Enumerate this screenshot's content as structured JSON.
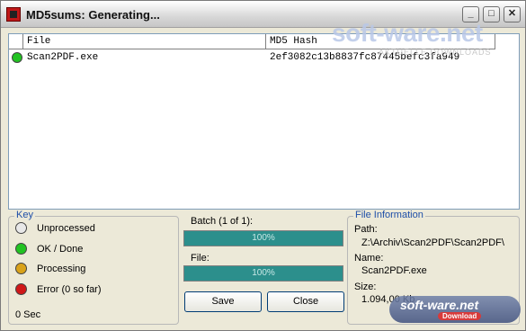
{
  "window": {
    "title": "MD5sums: Generating..."
  },
  "titlebar_buttons": {
    "minimize": "_",
    "maximize": "□",
    "close": "✕"
  },
  "list": {
    "columns": [
      "File",
      "MD5 Hash"
    ],
    "rows": [
      {
        "status": "ok",
        "file": "Scan2PDF.exe",
        "hash": "2ef3082c13b8837fc87445befc3fa949"
      }
    ]
  },
  "key": {
    "title": "Key",
    "items": [
      {
        "label": "Unprocessed",
        "color": "#e8e8e8"
      },
      {
        "label": "OK / Done",
        "color": "#22c322"
      },
      {
        "label": "Processing",
        "color": "#d9a21a"
      },
      {
        "label": "Error (0 so far)",
        "color": "#d01818"
      }
    ],
    "elapsed": "0 Sec"
  },
  "progress": {
    "batch_label": "Batch (1 of 1):",
    "batch_percent": "100%",
    "file_label": "File:",
    "file_percent": "100%"
  },
  "buttons": {
    "save": "Save",
    "close": "Close"
  },
  "file_info": {
    "title": "File Information",
    "path_label": "Path:",
    "path_value": "Z:\\Archiv\\Scan2PDF\\Scan2PDF\\",
    "name_label": "Name:",
    "name_value": "Scan2PDF.exe",
    "size_label": "Size:",
    "size_value": "1.094,00 Kb"
  },
  "watermark": {
    "top": "soft-ware.net",
    "sub": "AKTUELLE DOWNLOADS",
    "badge": "soft-ware.net",
    "badge_sub": "Download"
  }
}
